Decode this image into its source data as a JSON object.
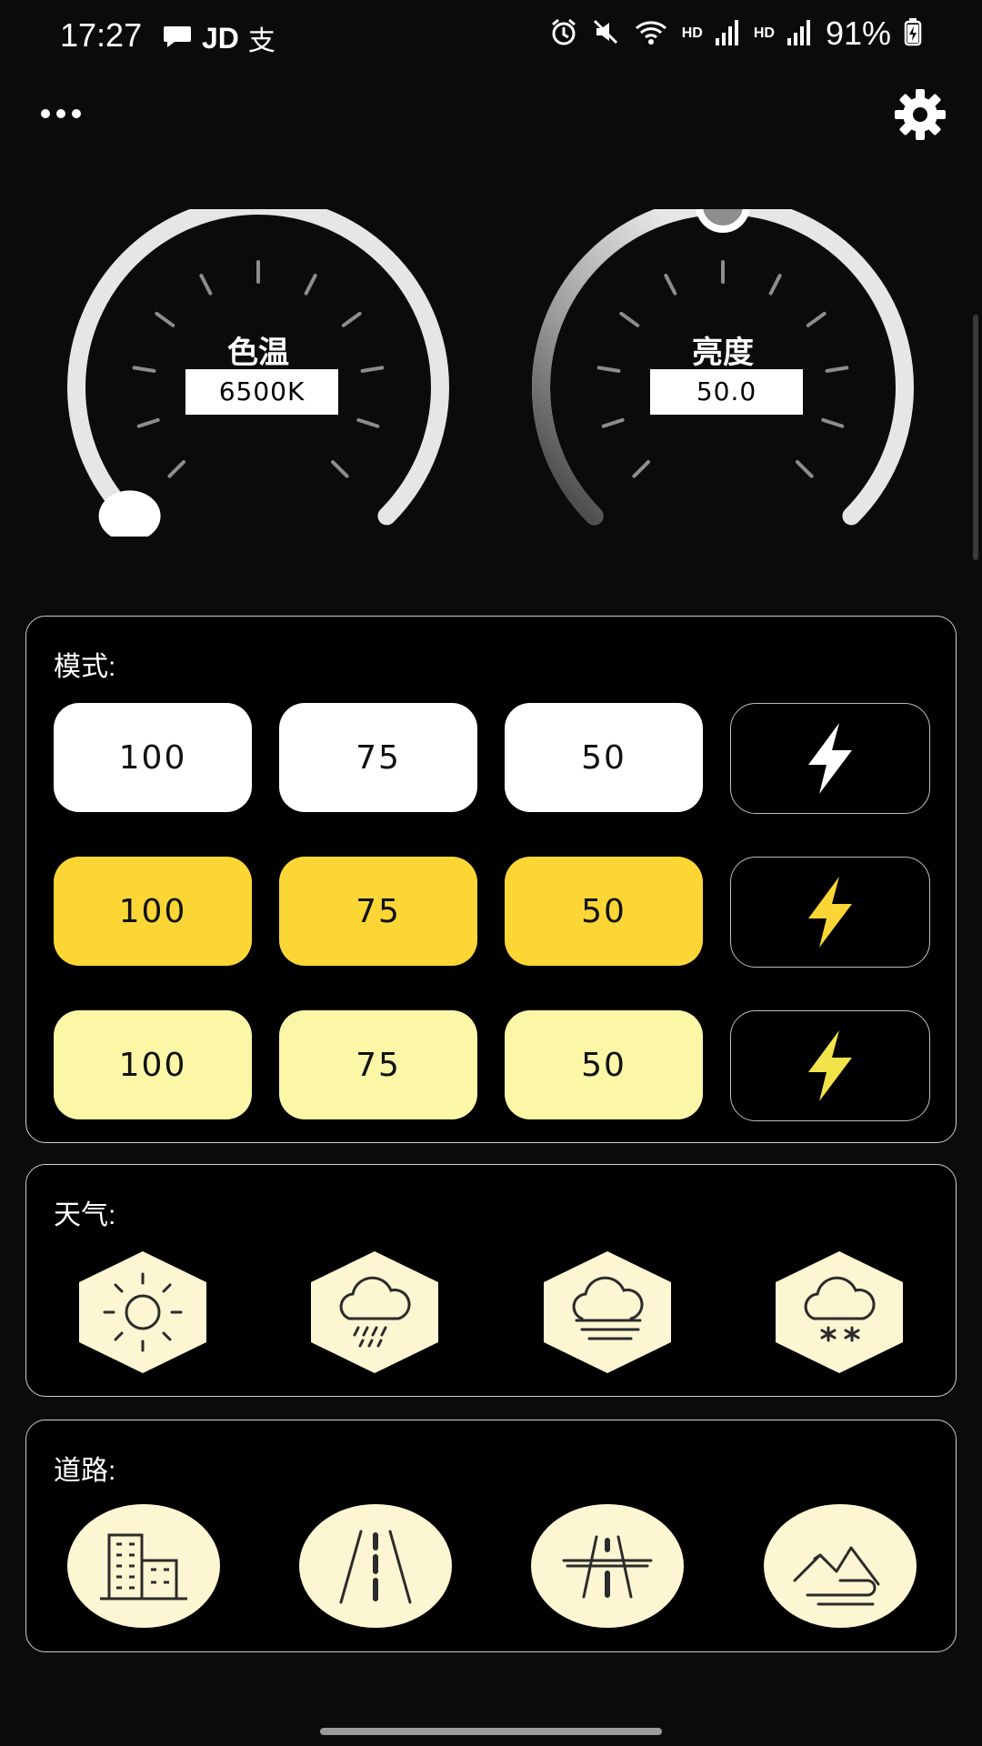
{
  "status_bar": {
    "time": "17:27",
    "battery": "91%",
    "left_icons": [
      "chat-bubble-icon",
      "jd-app-icon",
      "alipay-icon"
    ],
    "right_icons": [
      "alarm-icon",
      "mute-icon",
      "wifi-icon",
      "hd-signal-icon",
      "hd-signal-icon",
      "battery-charging-icon"
    ],
    "hd_label": "HD",
    "jd_label": "JD",
    "alipay_label": "支"
  },
  "toolbar": {
    "more_icon": "more-dots-icon",
    "settings_icon": "gear-icon"
  },
  "gauges": {
    "color_temp": {
      "title": "色温",
      "value": "6500K",
      "level": 0.0
    },
    "brightness": {
      "title": "亮度",
      "value": "50.0",
      "level": 0.5
    }
  },
  "mode_panel": {
    "title": "模式:",
    "rows": [
      {
        "color": "#ffffff",
        "flash_color": "#ffffff",
        "buttons": [
          "100",
          "75",
          "50"
        ]
      },
      {
        "color": "#fbd635",
        "flash_color": "#fbd635",
        "buttons": [
          "100",
          "75",
          "50"
        ]
      },
      {
        "color": "#fbf7a6",
        "flash_color": "#f3e34a",
        "buttons": [
          "100",
          "75",
          "50"
        ]
      }
    ],
    "flash_icon": "lightning-icon"
  },
  "weather_panel": {
    "title": "天气:",
    "items": [
      "sun-icon",
      "rain-icon",
      "fog-icon",
      "snow-icon"
    ]
  },
  "road_panel": {
    "title": "道路:",
    "items": [
      "city-buildings-icon",
      "road-icon",
      "highway-icon",
      "mountain-road-icon"
    ]
  },
  "colors": {
    "background": "#0b0b0b",
    "accent_yellow": "#fbd635",
    "pale_yellow": "#fbf7a6",
    "icon_fill": "#fdf6d2"
  }
}
